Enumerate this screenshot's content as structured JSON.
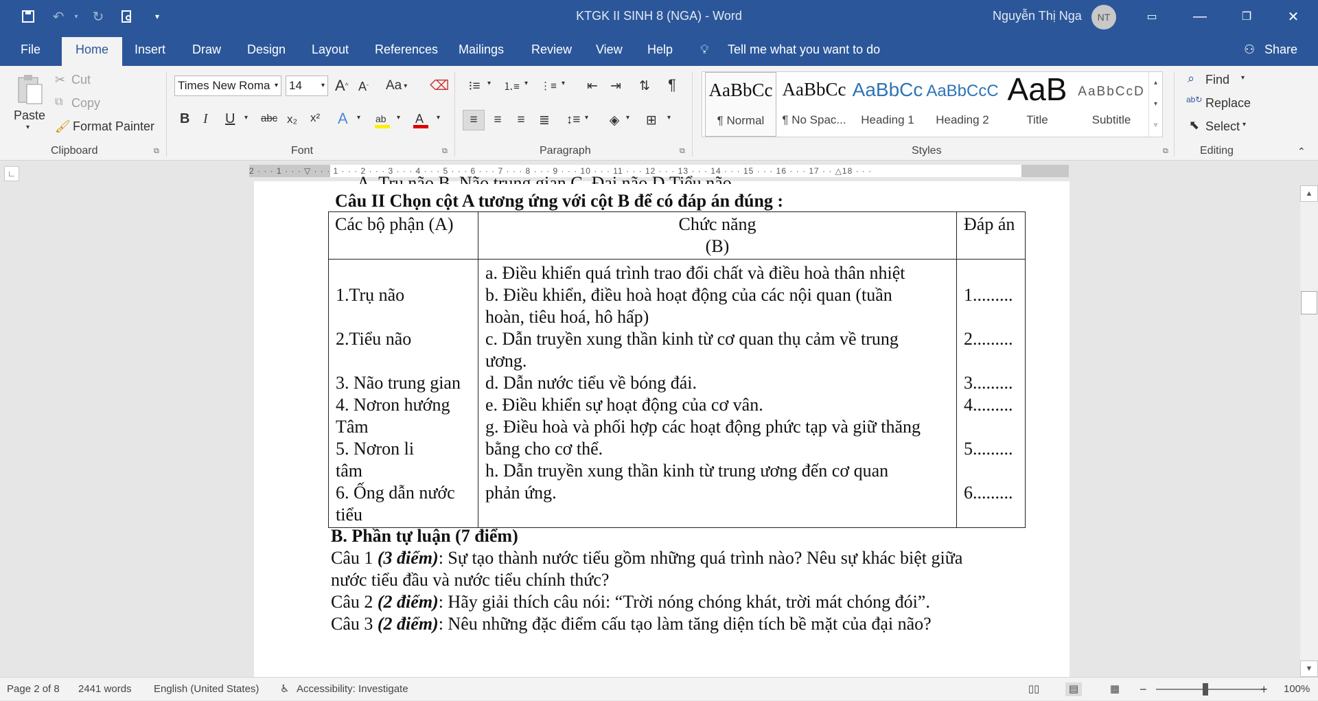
{
  "window": {
    "title": "KTGK II SINH 8 (NGA)  -  Word",
    "user_name": "Nguyễn Thị Nga",
    "user_initials": "NT"
  },
  "menu": {
    "tabs": [
      "File",
      "Home",
      "Insert",
      "Draw",
      "Design",
      "Layout",
      "References",
      "Mailings",
      "Review",
      "View",
      "Help"
    ],
    "tell_me": "Tell me what you want to do",
    "share": "Share"
  },
  "ribbon": {
    "clipboard": {
      "paste": "Paste",
      "cut": "Cut",
      "copy": "Copy",
      "format_painter": "Format Painter",
      "label": "Clipboard"
    },
    "font": {
      "font_name": "Times New Roma",
      "font_size": "14",
      "label": "Font",
      "bold": "B",
      "italic": "I",
      "underline": "U",
      "strike": "abc",
      "subscript": "x₂",
      "superscript": "x²",
      "grow": "A",
      "shrink": "A",
      "change_case": "Aa"
    },
    "paragraph": {
      "label": "Paragraph"
    },
    "styles": {
      "label": "Styles",
      "items": [
        {
          "preview": "AaBbCc",
          "name": "¶ Normal"
        },
        {
          "preview": "AaBbCc",
          "name": "¶ No Spac..."
        },
        {
          "preview": "AaBbCc",
          "name": "Heading 1"
        },
        {
          "preview": "AaBbCcC",
          "name": "Heading 2"
        },
        {
          "preview": "AaB",
          "name": "Title"
        },
        {
          "preview": "AaBbCcD",
          "name": "Subtitle"
        }
      ]
    },
    "editing": {
      "find": "Find",
      "replace": "Replace",
      "select": "Select",
      "label": "Editing"
    }
  },
  "ruler": {
    "ticks": "2 · · · 1 · · · ▽ · · · 1 · · · 2 · · · 3 · · · 4 · · · 5 · · · 6 · · · 7 · · · 8 · · · 9 · · · 10 · · · 11 · · · 12 · · · 13 · · · 14 · · · 15 · · · 16 · · · 17 · · △18 · · ·"
  },
  "document": {
    "prev_line": "A.  Trụ não                  B. Não trung gian         C. Đại não              D.Tiểu não",
    "q2_title": "Câu II  Chọn cột A tương ứng với cột B để có đáp án đúng :",
    "table": {
      "headers": {
        "a": "Các bộ phận (A)",
        "b1": "Chức năng",
        "b2": "(B)",
        "c": "Đáp án"
      },
      "col_a": [
        "",
        "1.Trụ não",
        "",
        "2.Tiểu não",
        "",
        "3. Não trung gian",
        "4. Nơron hướng",
        "Tâm",
        "5. Nơron li",
        "tâm",
        "6. Ống dẫn nước",
        "tiểu"
      ],
      "col_b": [
        "a. Điều khiển quá trình trao đổi chất và điều hoà thân nhiệt",
        "b. Điều khiển, điều hoà hoạt động của các nội quan (tuần",
        "hoàn, tiêu hoá, hô hấp)",
        "c. Dẫn truyền xung thần kinh từ cơ quan thụ cảm về trung",
        "ương.",
        "d. Dẫn nước tiểu về bóng đái.",
        "e. Điều khiển sự hoạt động của cơ vân.",
        "g. Điều hoà và phối hợp các hoạt động phức tạp và giữ thăng",
        "bằng cho cơ thể.",
        "h. Dẫn truyền xung thần kinh từ trung ương đến cơ quan",
        "phản ứng.",
        ""
      ],
      "col_c": [
        "",
        "1.........",
        "",
        "2.........",
        "",
        "3.........",
        "4.........",
        "",
        "5.........",
        "",
        "6.........",
        ""
      ]
    },
    "part_b": "B. Phần tự luận (7 điểm)",
    "q1": {
      "prefix": "Câu 1 ",
      "points": "(3 điểm)",
      "text": ": Sự tạo thành nước tiểu gồm những quá trình nào? Nêu sự khác biệt giữa",
      "line2": "nước tiểu đầu và nước tiểu chính thức?"
    },
    "q2": {
      "prefix": "Câu 2 ",
      "points": "(2 điểm)",
      "text": ":  Hãy giải thích câu nói: “Trời nóng chóng khát, trời mát chóng đói”."
    },
    "q3": {
      "prefix": "Câu 3 ",
      "points": "(2 điểm)",
      "text": ":  Nêu những đặc điểm cấu tạo làm tăng diện tích bề mặt của đại não?"
    }
  },
  "status": {
    "page": "Page 2 of 8",
    "words": "2441 words",
    "language": "English (United States)",
    "accessibility": "Accessibility: Investigate",
    "zoom": "100%"
  },
  "colors": {
    "accent": "#2b579a",
    "ribbon_bg": "#f3f3f3",
    "doc_bg": "#e6e6e6"
  }
}
